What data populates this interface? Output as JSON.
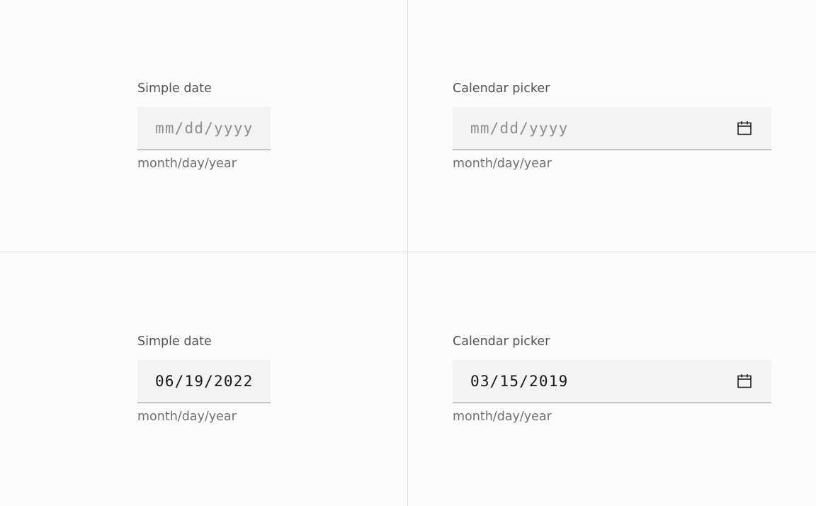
{
  "panels": [
    {
      "label": "Simple date",
      "input_text": "mm/dd/yyyy",
      "input_state": "placeholder",
      "helper": "month/day/year",
      "has_calendar_icon": false
    },
    {
      "label": "Calendar picker",
      "input_text": "mm/dd/yyyy",
      "input_state": "placeholder",
      "helper": "month/day/year",
      "has_calendar_icon": true,
      "icon": "calendar-icon"
    },
    {
      "label": "Simple date",
      "input_text": "06/19/2022",
      "input_state": "value",
      "helper": "month/day/year",
      "has_calendar_icon": false
    },
    {
      "label": "Calendar picker",
      "input_text": "03/15/2019",
      "input_state": "value",
      "helper": "month/day/year",
      "has_calendar_icon": true,
      "icon": "calendar-icon"
    }
  ],
  "colors": {
    "background": "#fcfcfc",
    "field_background": "#f3f3f3",
    "field_border": "#8d8d8d",
    "label_text": "#525252",
    "placeholder_text": "#8d8d8d",
    "value_text": "#161616",
    "helper_text": "#6f6f6f",
    "divider": "#dcdcdc"
  }
}
